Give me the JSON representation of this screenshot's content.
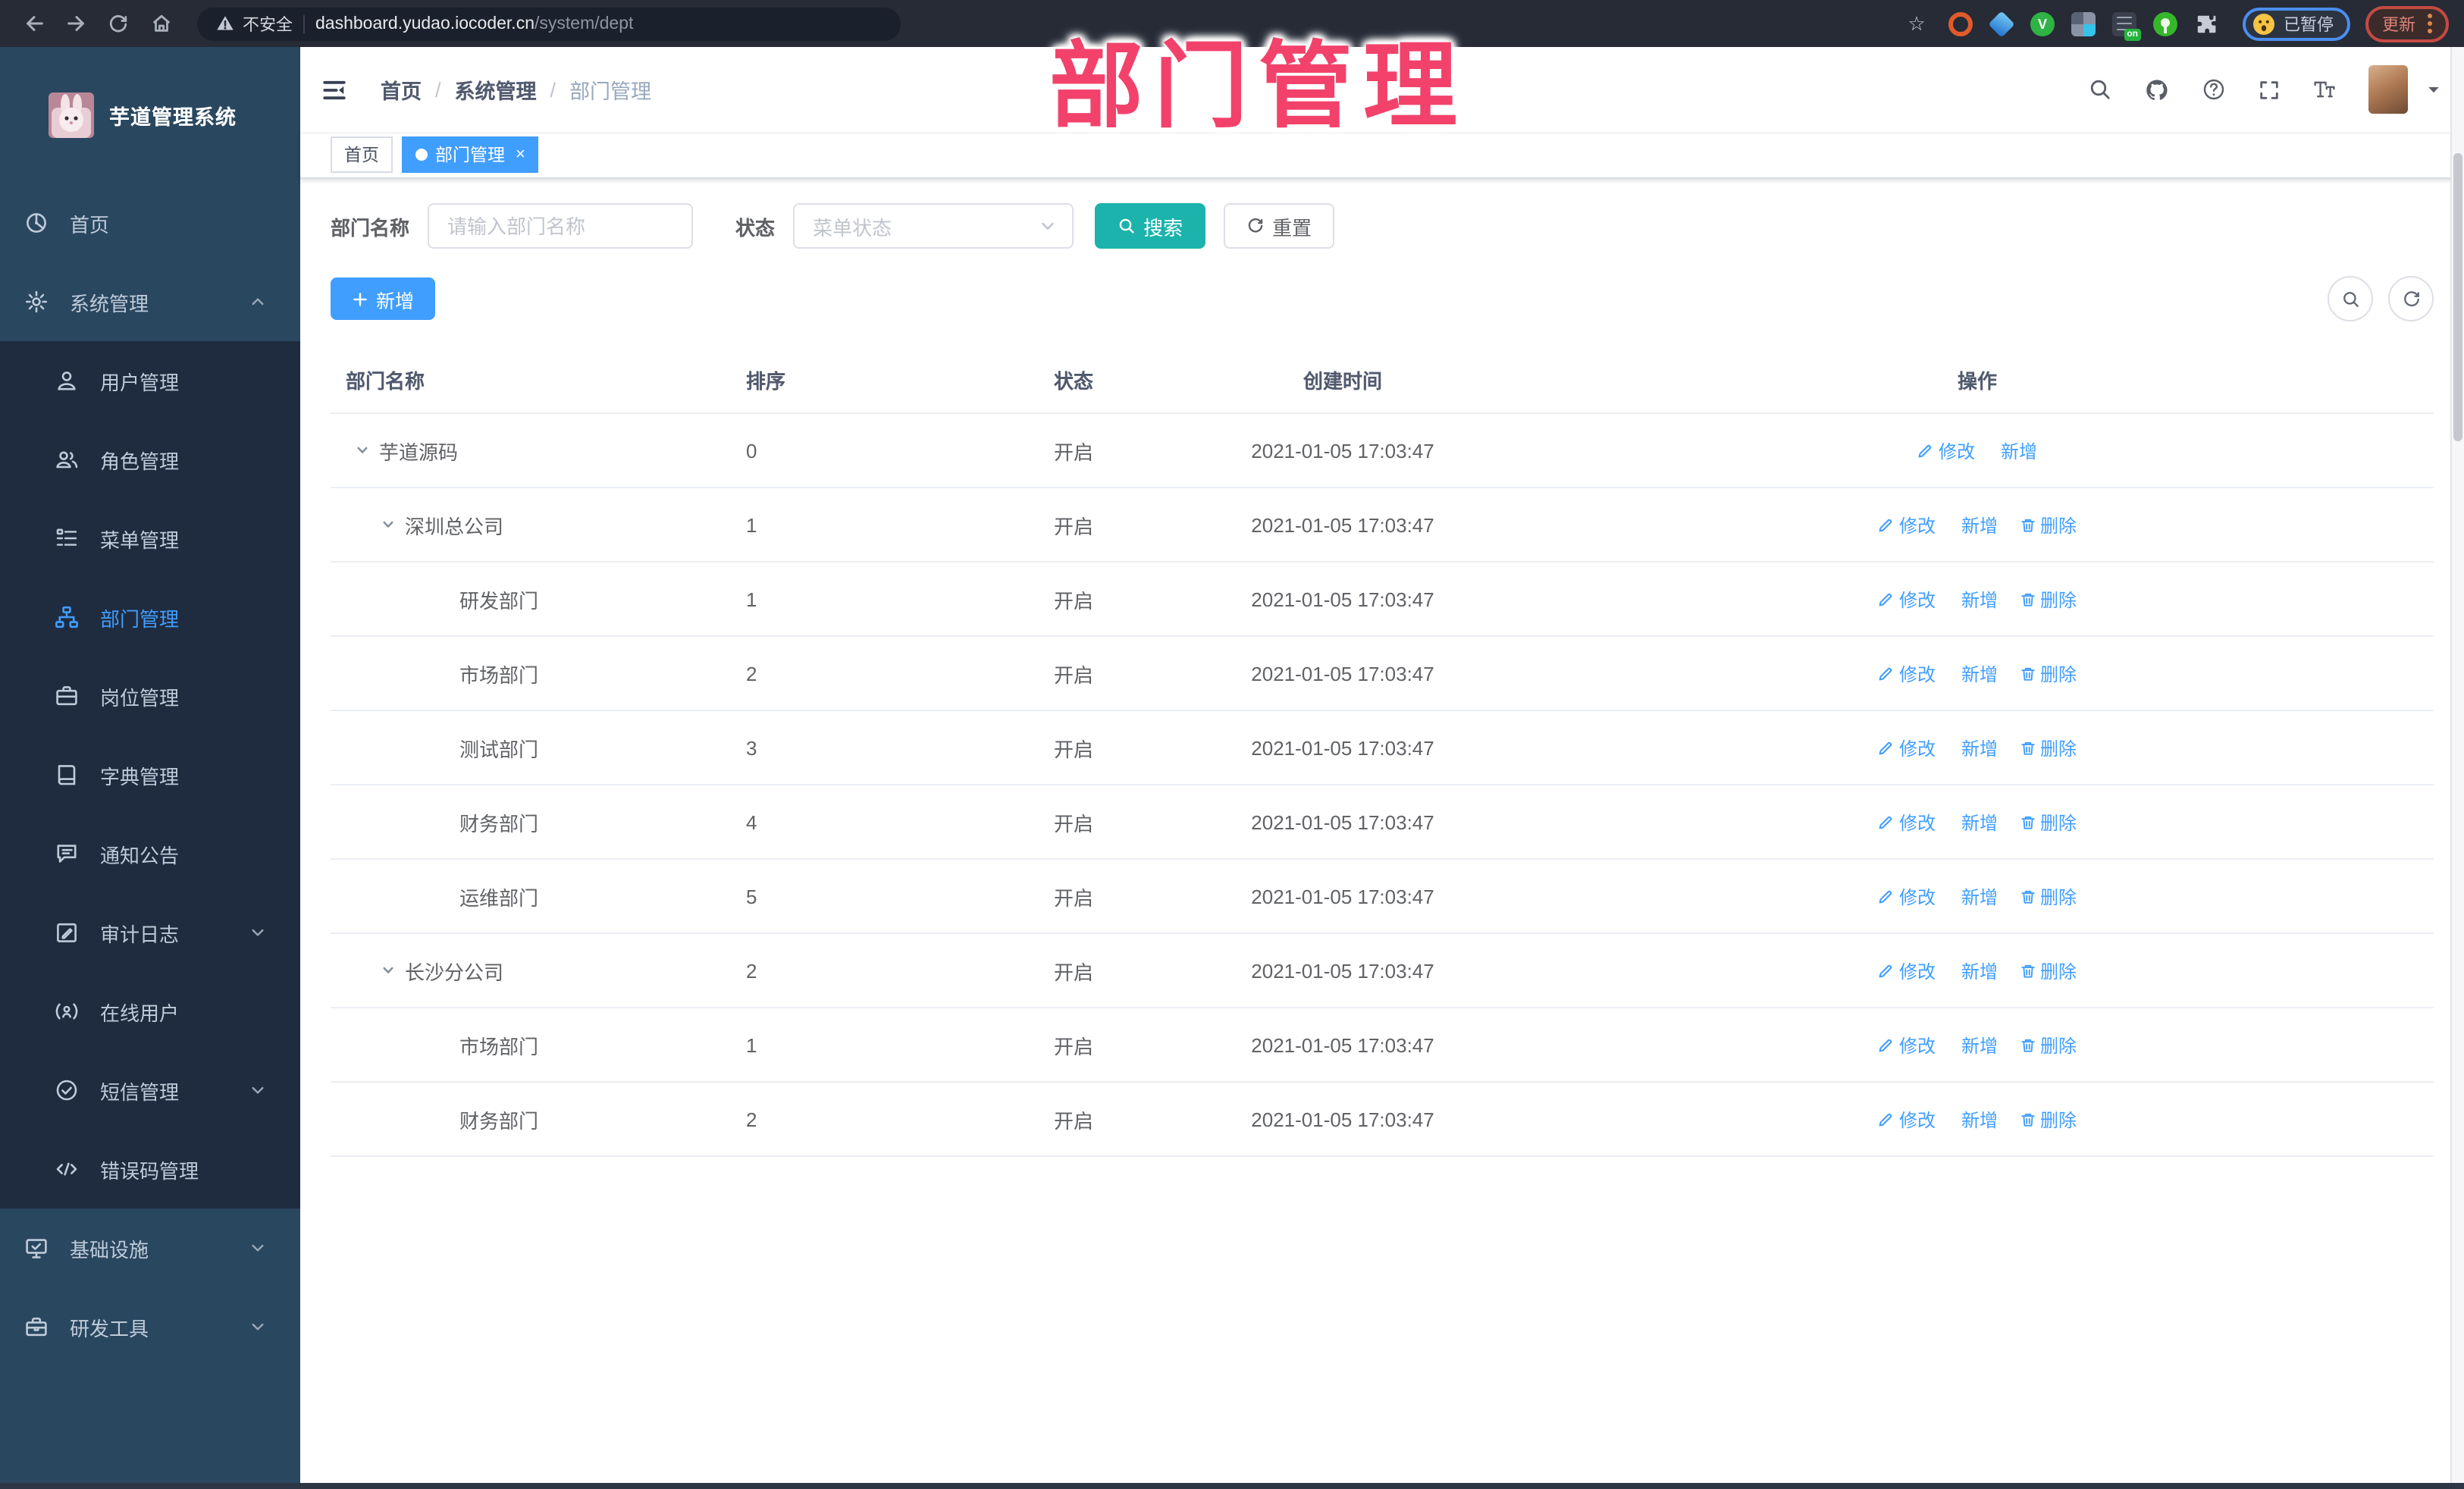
{
  "colors": {
    "accent": "#409EFF",
    "search_button": "#1BB3AC",
    "overlay_pink": "#F2426B",
    "sidebar_bg": "#2A4760",
    "submenu_bg": "#1F2C40",
    "link": "#409EFF"
  },
  "overlay": {
    "title": "部门管理"
  },
  "browser": {
    "security_label": "不安全",
    "url_host": "dashboard.yudao.iocoder.cn",
    "url_path": "/system/dept",
    "extension_badge": "on",
    "profile_label": "已暂停",
    "update_label": "更新"
  },
  "sidebar": {
    "app_title": "芋道管理系统",
    "items": [
      {
        "label": "首页",
        "icon": "dashboard-icon",
        "level": 1
      },
      {
        "label": "系统管理",
        "icon": "gear-icon",
        "level": 1,
        "chevron": "up"
      },
      {
        "label": "用户管理",
        "icon": "user-icon",
        "level": 2
      },
      {
        "label": "角色管理",
        "icon": "users-icon",
        "level": 2
      },
      {
        "label": "菜单管理",
        "icon": "menu-tree-icon",
        "level": 2
      },
      {
        "label": "部门管理",
        "icon": "org-chart-icon",
        "level": 2,
        "active": true
      },
      {
        "label": "岗位管理",
        "icon": "briefcase-icon",
        "level": 2
      },
      {
        "label": "字典管理",
        "icon": "dictionary-icon",
        "level": 2
      },
      {
        "label": "通知公告",
        "icon": "announcement-icon",
        "level": 2
      },
      {
        "label": "审计日志",
        "icon": "audit-log-icon",
        "level": 2,
        "chevron": "down"
      },
      {
        "label": "在线用户",
        "icon": "online-user-icon",
        "level": 2
      },
      {
        "label": "短信管理",
        "icon": "sms-icon",
        "level": 2,
        "chevron": "down"
      },
      {
        "label": "错误码管理",
        "icon": "error-code-icon",
        "level": 2
      },
      {
        "label": "基础设施",
        "icon": "infrastructure-icon",
        "level": 1,
        "chevron": "down"
      },
      {
        "label": "研发工具",
        "icon": "dev-tools-icon",
        "level": 1,
        "chevron": "down"
      }
    ]
  },
  "header": {
    "breadcrumb": [
      "首页",
      "系统管理",
      "部门管理"
    ],
    "icons": [
      "search-icon",
      "github-icon",
      "question-icon",
      "fullscreen-icon",
      "font-size-icon"
    ]
  },
  "tabs": [
    {
      "label": "首页",
      "active": false,
      "closable": false
    },
    {
      "label": "部门管理",
      "active": true,
      "closable": true
    }
  ],
  "filters": {
    "name_label": "部门名称",
    "name_placeholder": "请输入部门名称",
    "name_value": "",
    "status_label": "状态",
    "status_placeholder": "菜单状态",
    "search_label": "搜索",
    "reset_label": "重置"
  },
  "toolbar": {
    "add_label": "新增"
  },
  "table": {
    "columns": [
      "部门名称",
      "排序",
      "状态",
      "创建时间",
      "操作"
    ],
    "action_labels": {
      "edit": "修改",
      "add": "新增",
      "delete": "删除"
    },
    "rows": [
      {
        "level": 1,
        "caret": true,
        "name": "芋道源码",
        "sort": "0",
        "status": "开启",
        "time": "2021-01-05 17:03:47",
        "actions": [
          "edit",
          "add"
        ]
      },
      {
        "level": 2,
        "caret": true,
        "name": "深圳总公司",
        "sort": "1",
        "status": "开启",
        "time": "2021-01-05 17:03:47",
        "actions": [
          "edit",
          "add",
          "delete"
        ]
      },
      {
        "level": 3,
        "caret": false,
        "name": "研发部门",
        "sort": "1",
        "status": "开启",
        "time": "2021-01-05 17:03:47",
        "actions": [
          "edit",
          "add",
          "delete"
        ]
      },
      {
        "level": 3,
        "caret": false,
        "name": "市场部门",
        "sort": "2",
        "status": "开启",
        "time": "2021-01-05 17:03:47",
        "actions": [
          "edit",
          "add",
          "delete"
        ]
      },
      {
        "level": 3,
        "caret": false,
        "name": "测试部门",
        "sort": "3",
        "status": "开启",
        "time": "2021-01-05 17:03:47",
        "actions": [
          "edit",
          "add",
          "delete"
        ]
      },
      {
        "level": 3,
        "caret": false,
        "name": "财务部门",
        "sort": "4",
        "status": "开启",
        "time": "2021-01-05 17:03:47",
        "actions": [
          "edit",
          "add",
          "delete"
        ]
      },
      {
        "level": 3,
        "caret": false,
        "name": "运维部门",
        "sort": "5",
        "status": "开启",
        "time": "2021-01-05 17:03:47",
        "actions": [
          "edit",
          "add",
          "delete"
        ]
      },
      {
        "level": 2,
        "caret": true,
        "name": "长沙分公司",
        "sort": "2",
        "status": "开启",
        "time": "2021-01-05 17:03:47",
        "actions": [
          "edit",
          "add",
          "delete"
        ]
      },
      {
        "level": 3,
        "caret": false,
        "name": "市场部门",
        "sort": "1",
        "status": "开启",
        "time": "2021-01-05 17:03:47",
        "actions": [
          "edit",
          "add",
          "delete"
        ]
      },
      {
        "level": 3,
        "caret": false,
        "name": "财务部门",
        "sort": "2",
        "status": "开启",
        "time": "2021-01-05 17:03:47",
        "actions": [
          "edit",
          "add",
          "delete"
        ]
      }
    ]
  }
}
